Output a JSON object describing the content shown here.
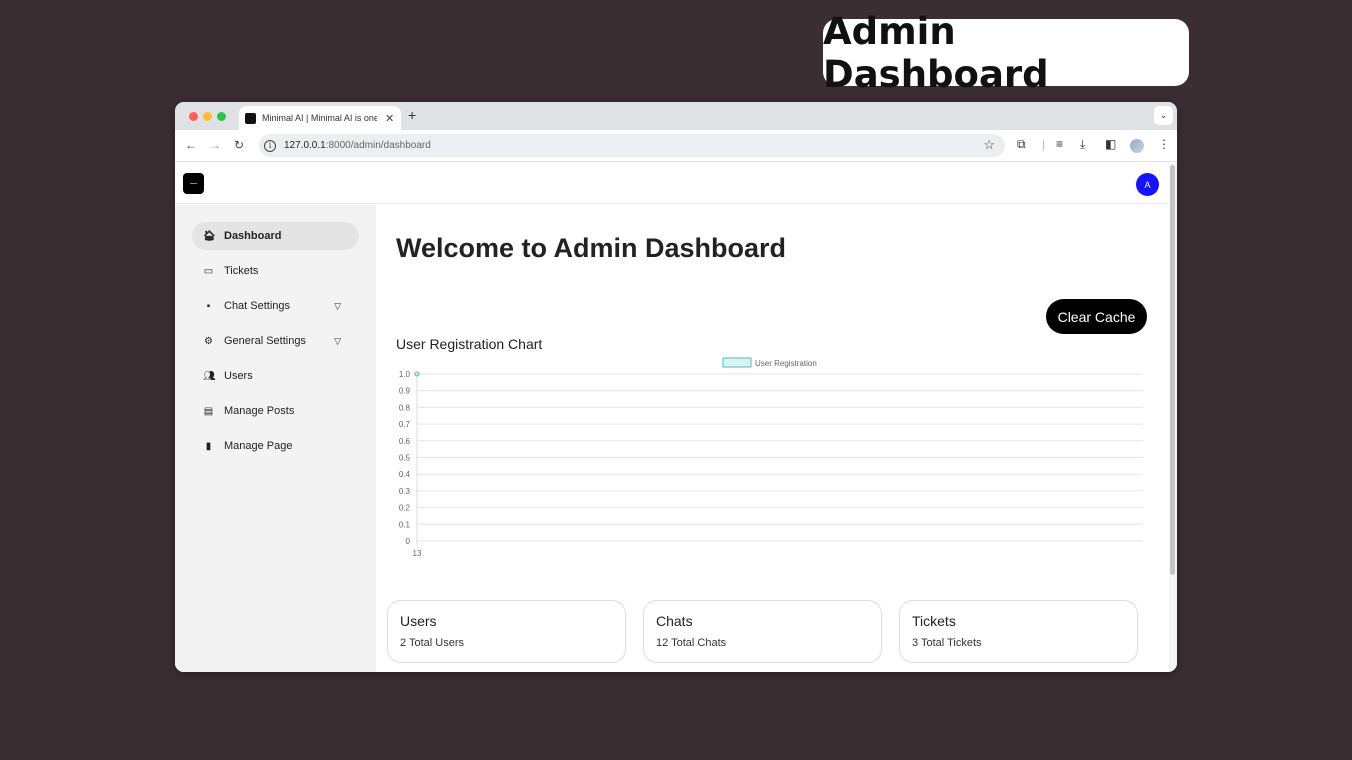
{
  "overlay": {
    "title": "Admin Dashboard"
  },
  "browser": {
    "tab_title": "Minimal AI | Minimal AI is one",
    "tab_close": "✕",
    "new_tab": "+",
    "tab_dropdown": "⌄",
    "url_host": "127.0.0.1",
    "url_rest": ":8000/admin/dashboard",
    "icons": [
      "back-icon",
      "forward-icon",
      "reload-icon",
      "info-icon",
      "star-icon",
      "extensions-icon",
      "reading-list-icon",
      "download-icon",
      "side-panel-icon",
      "profile-icon",
      "menu-icon"
    ]
  },
  "app": {
    "avatar_letter": "A"
  },
  "sidebar": {
    "items": [
      {
        "label": "Dashboard",
        "icon": "🏠︎",
        "active": true
      },
      {
        "label": "Tickets",
        "icon": "▭"
      },
      {
        "label": "Chat Settings",
        "icon": "▪",
        "caret": "▽"
      },
      {
        "label": "General Settings",
        "icon": "⚙",
        "caret": "▽"
      },
      {
        "label": "Users",
        "icon": "👥︎"
      },
      {
        "label": "Manage Posts",
        "icon": "▤"
      },
      {
        "label": "Manage Page",
        "icon": "▮"
      }
    ]
  },
  "main": {
    "heading": "Welcome to Admin Dashboard",
    "clear_cache_label": "Clear Cache",
    "chart_title": "User Registration Chart"
  },
  "chart_data": {
    "type": "line",
    "title": "User Registration Chart",
    "x": [
      "13"
    ],
    "series": [
      {
        "name": "User Registration",
        "values": [
          1.0
        ]
      }
    ],
    "ylim": [
      0,
      1.0
    ],
    "y_ticks": [
      "1.0",
      "0.9",
      "0.8",
      "0.7",
      "0.6",
      "0.5",
      "0.4",
      "0.3",
      "0.2",
      "0.1",
      "0"
    ],
    "grid": true,
    "legend": "top-center",
    "color": "#4bc0c0"
  },
  "cards": [
    {
      "title": "Users",
      "value": "2 Total Users"
    },
    {
      "title": "Chats",
      "value": "12 Total Chats"
    },
    {
      "title": "Tickets",
      "value": "3 Total Tickets"
    }
  ]
}
